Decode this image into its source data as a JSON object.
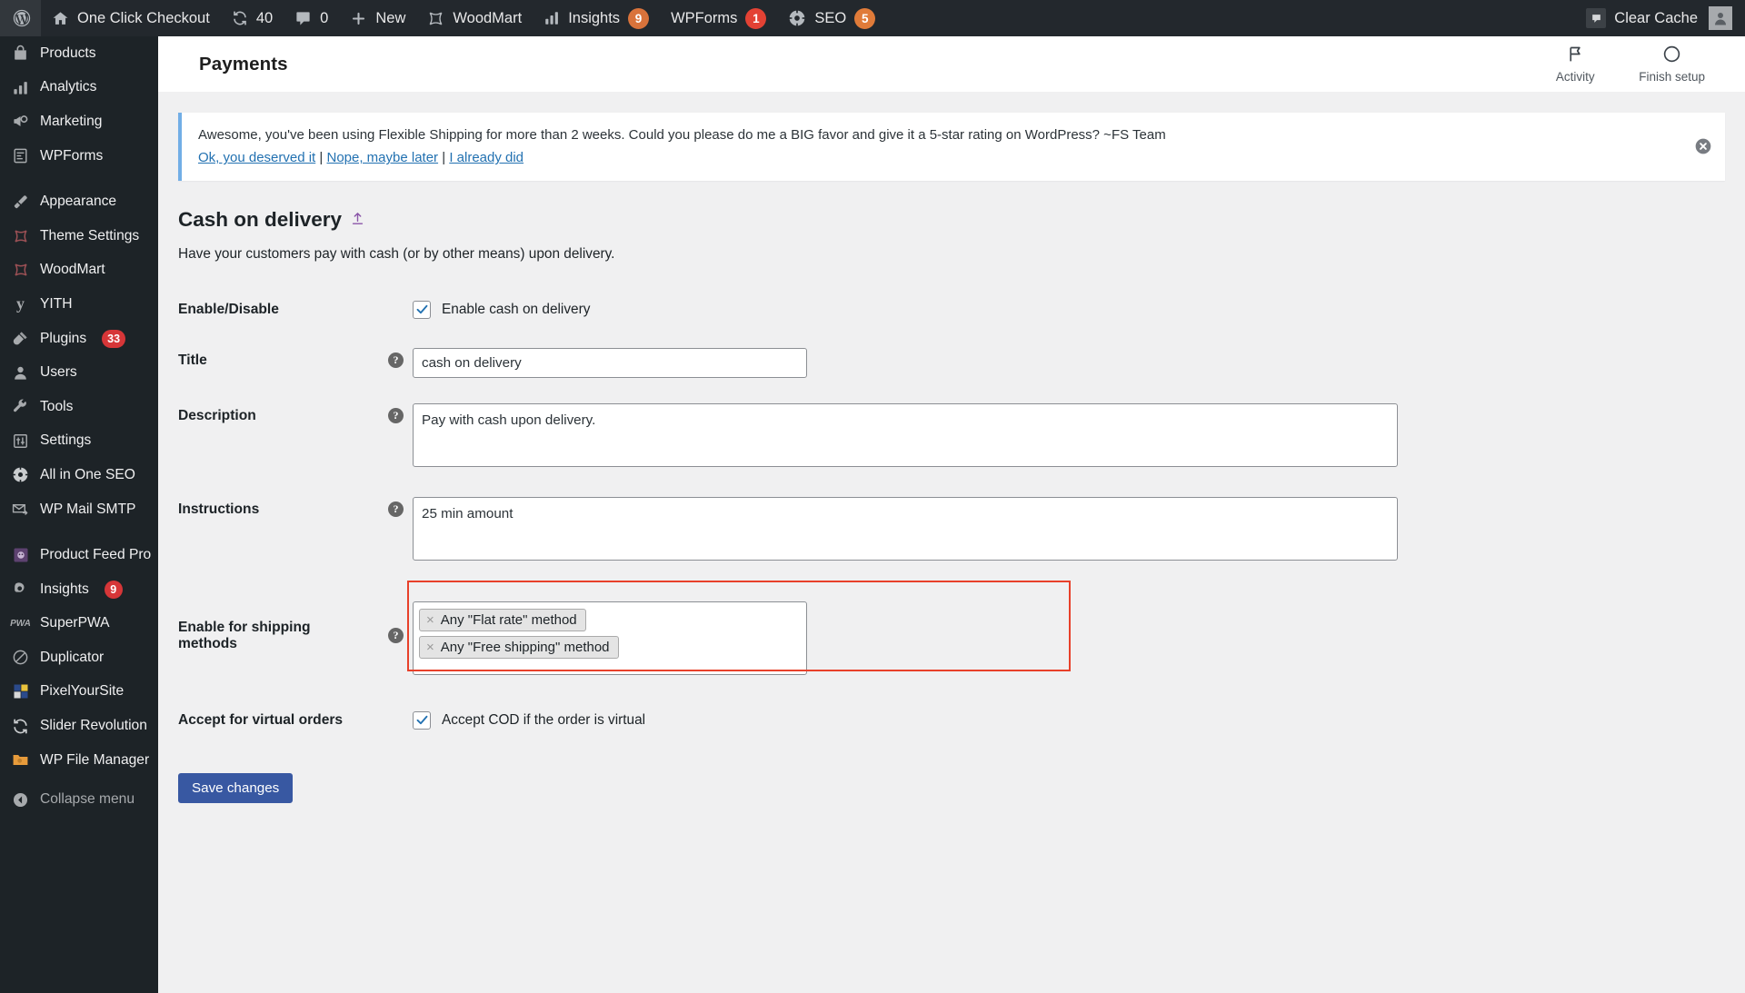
{
  "adminbar": {
    "items": [
      {
        "name": "wp-logo",
        "icon": "wordpress-icon",
        "label": ""
      },
      {
        "name": "site-name",
        "icon": "home-icon",
        "label": "One Click Checkout"
      },
      {
        "name": "updates",
        "icon": "updates-icon",
        "label": "40"
      },
      {
        "name": "comments",
        "icon": "comment-icon",
        "label": "0"
      },
      {
        "name": "new-content",
        "icon": "plus-icon",
        "label": "New"
      },
      {
        "name": "woodmart",
        "icon": "woodmart-icon",
        "label": "WoodMart"
      },
      {
        "name": "insights",
        "icon": "chart-bars-icon",
        "label": "Insights",
        "count": "9",
        "count_color": "#d9733b"
      },
      {
        "name": "wpforms",
        "icon": "",
        "label": "WPForms",
        "count": "1",
        "count_color": "#e34234"
      },
      {
        "name": "seo",
        "icon": "gear-circle-icon",
        "label": "SEO",
        "count": "5",
        "count_color": "#e07b39"
      }
    ],
    "clear_cache_label": "Clear Cache",
    "avatar_label": "avatar"
  },
  "sidebar": {
    "items": [
      {
        "label": "Products",
        "icon": "bag-icon"
      },
      {
        "label": "Analytics",
        "icon": "chart-bars-icon"
      },
      {
        "label": "Marketing",
        "icon": "megaphone-icon"
      },
      {
        "label": "WPForms",
        "icon": "form-icon"
      },
      {
        "gap": true
      },
      {
        "label": "Appearance",
        "icon": "brush-icon"
      },
      {
        "label": "Theme Settings",
        "icon": "woodmart-icon"
      },
      {
        "label": "WoodMart",
        "icon": "woodmart-icon"
      },
      {
        "label": "YITH",
        "icon": "yith-icon"
      },
      {
        "label": "Plugins",
        "icon": "plug-icon",
        "badge": "33"
      },
      {
        "label": "Users",
        "icon": "user-icon"
      },
      {
        "label": "Tools",
        "icon": "wrench-icon"
      },
      {
        "label": "Settings",
        "icon": "sliders-icon"
      },
      {
        "label": "All in One SEO",
        "icon": "gear-circle-icon"
      },
      {
        "label": "WP Mail SMTP",
        "icon": "mail-arrow-icon"
      },
      {
        "gap": true
      },
      {
        "label": "Product Feed Pro",
        "icon": "feed-icon"
      },
      {
        "label": "Insights",
        "icon": "monsterinsights-icon",
        "badge": "9"
      },
      {
        "label": "SuperPWA",
        "icon": "pwa-icon"
      },
      {
        "label": "Duplicator",
        "icon": "duplicator-icon"
      },
      {
        "label": "PixelYourSite",
        "icon": "pixel-icon"
      },
      {
        "label": "Slider Revolution",
        "icon": "refresh-icon"
      },
      {
        "label": "WP File Manager",
        "icon": "folder-icon"
      }
    ],
    "collapse_label": "Collapse menu"
  },
  "header": {
    "title": "Payments",
    "activity_label": "Activity",
    "finish_setup_label": "Finish setup"
  },
  "notice": {
    "text": "Awesome, you've been using Flexible Shipping for more than 2 weeks. Could you please do me a BIG favor and give it a 5-star rating on WordPress? ~FS Team",
    "link1": "Ok, you deserved it",
    "link2": "Nope, maybe later",
    "link3": "I already did",
    "separator": "|"
  },
  "gateway": {
    "heading": "Cash on delivery",
    "heading_icon": "share-arrow-icon",
    "description": "Have your customers pay with cash (or by other means) upon delivery.",
    "rows": {
      "enable": {
        "label": "Enable/Disable",
        "checkbox_label": "Enable cash on delivery",
        "checked": true
      },
      "title": {
        "label": "Title",
        "value": "cash on delivery",
        "help": "?"
      },
      "description": {
        "label": "Description",
        "value": "Pay with cash upon delivery.",
        "help": "?"
      },
      "instructions": {
        "label": "Instructions",
        "value": "25 min amount",
        "help": "?"
      },
      "shipping_methods": {
        "label": "Enable for shipping methods",
        "help": "?",
        "tokens": [
          {
            "remove": "×",
            "label": "Any \"Flat rate\" method"
          },
          {
            "remove": "×",
            "label": "Any \"Free shipping\" method"
          }
        ],
        "highlight_color": "#e8402a"
      },
      "virtual": {
        "label": "Accept for virtual orders",
        "checkbox_label": "Accept COD if the order is virtual",
        "checked": true
      }
    },
    "save_label": "Save changes"
  },
  "colors": {
    "adminbar_bg": "#23282d",
    "sidebar_bg": "#1d2327",
    "content_bg": "#f0f0f1",
    "link": "#2271b1",
    "primary_button": "#3858a2",
    "notice_accent": "#72aee6",
    "checkbox_check": "#2271b1"
  }
}
